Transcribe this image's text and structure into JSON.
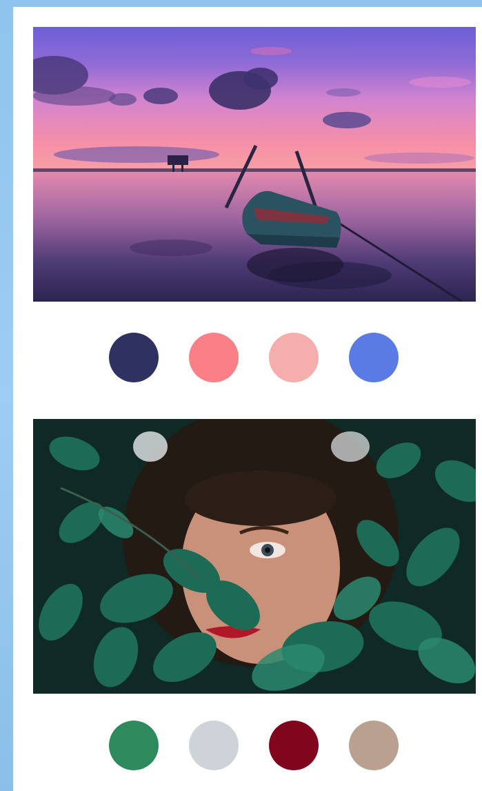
{
  "palettes": [
    {
      "photo": "sunset-lake-boat",
      "colors": [
        {
          "name": "navy",
          "hex": "#2f3160"
        },
        {
          "name": "coral",
          "hex": "#fa7f86"
        },
        {
          "name": "blush",
          "hex": "#f6aeac"
        },
        {
          "name": "royal-blue",
          "hex": "#5a7ae4"
        }
      ]
    },
    {
      "photo": "woman-behind-leaves",
      "colors": [
        {
          "name": "emerald",
          "hex": "#2c8a5c"
        },
        {
          "name": "light-gray",
          "hex": "#cdd3d9"
        },
        {
          "name": "burgundy",
          "hex": "#81051c"
        },
        {
          "name": "taupe",
          "hex": "#b9a08f"
        }
      ]
    }
  ]
}
